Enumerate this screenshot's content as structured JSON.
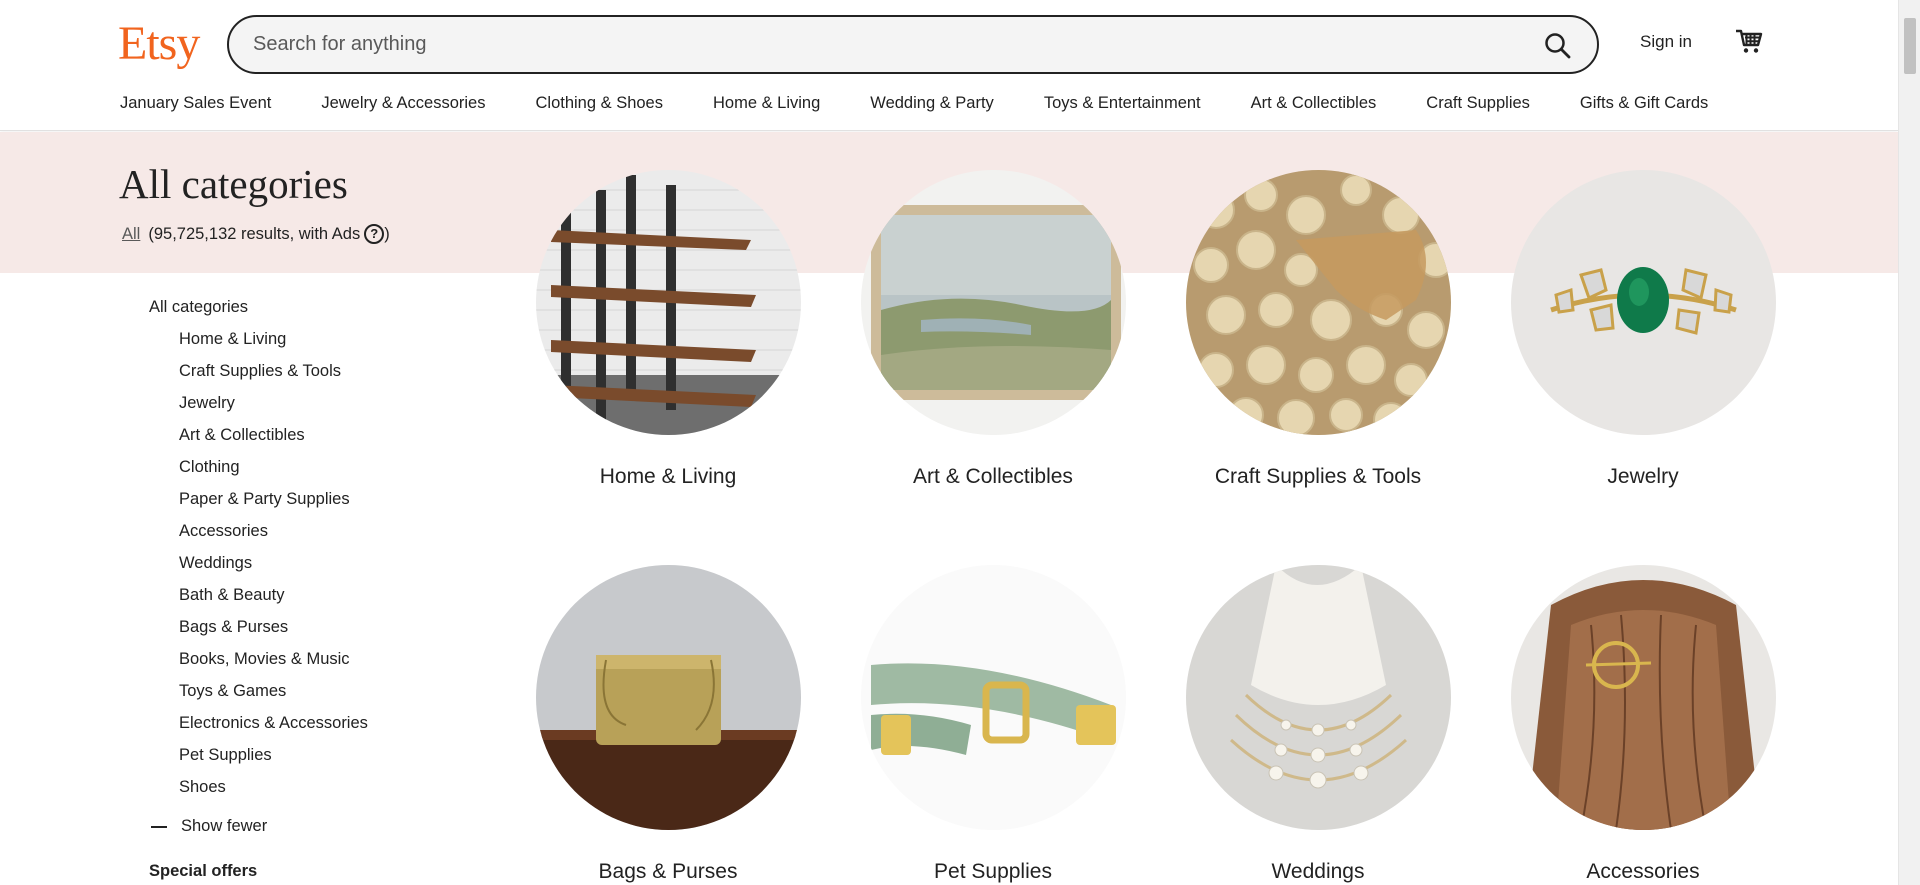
{
  "header": {
    "logo": "Etsy",
    "search_placeholder": "Search for anything",
    "signin_label": "Sign in"
  },
  "nav": {
    "items": [
      "January Sales Event",
      "Jewelry & Accessories",
      "Clothing & Shoes",
      "Home & Living",
      "Wedding & Party",
      "Toys & Entertainment",
      "Art & Collectibles",
      "Craft Supplies",
      "Gifts & Gift Cards"
    ]
  },
  "hero": {
    "title": "All categories",
    "all_link": "All",
    "results_text": "(95,725,132 results, with Ads",
    "help_symbol": "?",
    "close_paren": ")"
  },
  "sidebar": {
    "heading": "All categories",
    "items": [
      "Home & Living",
      "Craft Supplies & Tools",
      "Jewelry",
      "Art & Collectibles",
      "Clothing",
      "Paper & Party Supplies",
      "Accessories",
      "Weddings",
      "Bath & Beauty",
      "Bags & Purses",
      "Books, Movies & Music",
      "Toys & Games",
      "Electronics & Accessories",
      "Pet Supplies",
      "Shoes"
    ],
    "show_fewer": "Show fewer",
    "special_offers": "Special offers"
  },
  "grid": {
    "cards": [
      "Home & Living",
      "Art & Collectibles",
      "Craft Supplies & Tools",
      "Jewelry",
      "Bags & Purses",
      "Pet Supplies",
      "Weddings",
      "Accessories"
    ]
  },
  "colors": {
    "brand": "#F1641E",
    "band": "#f6e9e7"
  }
}
